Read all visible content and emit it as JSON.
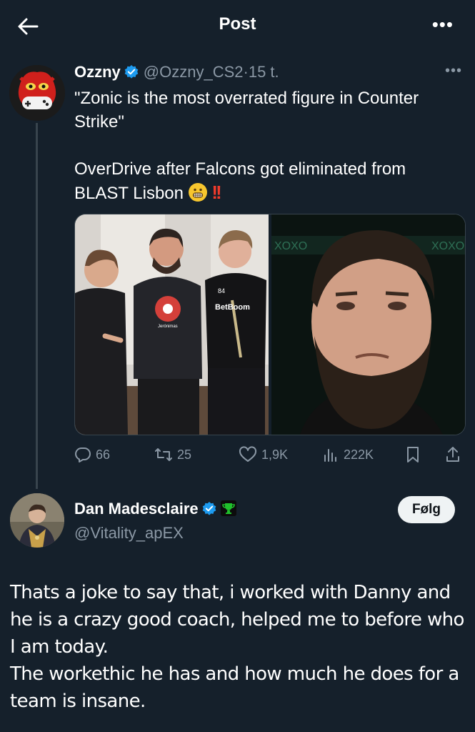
{
  "topbar": {
    "title": "Post",
    "more_icon": "more-horizontal-icon",
    "back_icon": "arrow-left-icon"
  },
  "post": {
    "author_name": "Ozzny",
    "handle": "@Ozzny_CS2",
    "separator": "·",
    "time": "15 t.",
    "text_line1": "\"Zonic is the most overrated figure in Counter Strike\"",
    "text_line2_before": "OverDrive after Falcons got eliminated from BLAST Lisbon",
    "emoji": "grimacing-face-emoji",
    "exclaim": "!!",
    "media_text": {
      "shirt_sponsor": "BetBoom",
      "shirt_number": "84",
      "hoodie_print": "Jerónimas",
      "banner": "XOXO"
    },
    "stats": {
      "replies": "66",
      "reposts": "25",
      "likes": "1,9K",
      "views": "222K"
    }
  },
  "reply": {
    "author_name": "Dan Madesclaire",
    "handle": "@Vitality_apEX",
    "follow_label": "Følg",
    "text_p1": "Thats a joke to say that, i worked with Danny and he is a crazy good coach, helped me to before who I am today.",
    "text_p2": "The workethic he has and how much he does for a team is insane."
  },
  "colors": {
    "background": "#15202b",
    "verified": "#1d9bf0",
    "muted": "#8b98a5",
    "affiliate_badge": "#20c02c"
  }
}
